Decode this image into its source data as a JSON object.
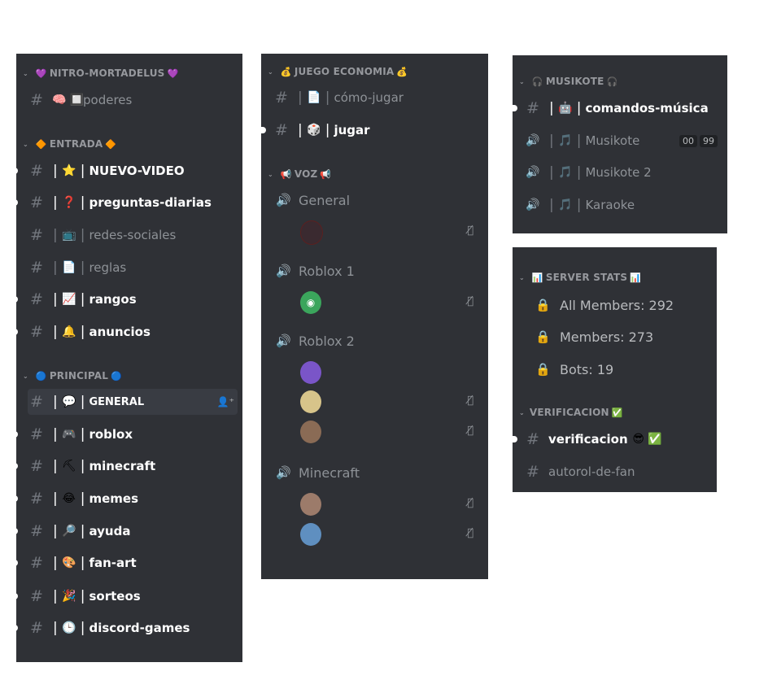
{
  "panel1": {
    "cat1": {
      "label": "NITRO-MORTADELUS",
      "emoji_l": "💜",
      "emoji_r": "💜"
    },
    "c1": {
      "emojis": "🧠 🔲",
      "name": "poderes"
    },
    "cat2": {
      "label": "ENTRADA",
      "emoji_l": "🔶",
      "emoji_r": "🔶"
    },
    "c2": {
      "emoji": "⭐",
      "name": "NUEVO-VIDEO"
    },
    "c3": {
      "emoji": "❓",
      "name": "preguntas-diarias"
    },
    "c4": {
      "emoji": "📺",
      "name": "redes-sociales"
    },
    "c5": {
      "emoji": "📄",
      "name": "reglas"
    },
    "c6": {
      "emoji": "📈",
      "name": "rangos"
    },
    "c7": {
      "emoji": "🔔",
      "name": "anuncios"
    },
    "cat3": {
      "label": "PRINCIPAL",
      "emoji_l": "🔵",
      "emoji_r": "🔵"
    },
    "c8": {
      "emoji": "💬",
      "name": "GENERAL"
    },
    "c9": {
      "emoji": "🎮",
      "name": "roblox"
    },
    "c10": {
      "emoji": "⛏",
      "name": "minecraft"
    },
    "c11": {
      "emoji": "😂",
      "name": "memes"
    },
    "c12": {
      "emoji": "🔎",
      "name": "ayuda"
    },
    "c13": {
      "emoji": "🎨",
      "name": "fan-art"
    },
    "c14": {
      "emoji": "🎉",
      "name": "sorteos"
    },
    "c15": {
      "emoji": "🕒",
      "name": "discord-games"
    }
  },
  "panel2": {
    "cat1": {
      "label": "JUEGO ECONOMIA",
      "emoji_l": "💰",
      "emoji_r": "💰"
    },
    "c1": {
      "emoji": "📄",
      "name": "cómo-jugar"
    },
    "c2": {
      "emoji": "🎲",
      "name": "jugar"
    },
    "cat2": {
      "label": "VOZ",
      "emoji_l": "📢",
      "emoji_r": "📢"
    },
    "v1": "General",
    "v2": "Roblox 1",
    "v3": "Roblox 2",
    "v4": "Minecraft"
  },
  "panel3": {
    "cat1": {
      "label": "MUSIKOTE",
      "emoji_l": "🎧",
      "emoji_r": "🎧"
    },
    "c1": {
      "emoji": "🤖",
      "name": "comandos-música"
    },
    "v1": {
      "emoji": "🎵",
      "name": "Musikote",
      "badge1": "00",
      "badge2": "99"
    },
    "v2": {
      "emoji": "🎵",
      "name": "Musikote 2"
    },
    "v3": {
      "emoji": "🎵",
      "name": "Karaoke"
    }
  },
  "panel4": {
    "cat1": {
      "label": "SERVER STATS",
      "emoji_l": "📊",
      "emoji_r": "📊"
    },
    "s1": "All Members: 292",
    "s2": "Members: 273",
    "s3": "Bots: 19",
    "cat2": {
      "label": "VERIFICACION",
      "emoji_r": "✅"
    },
    "c1": {
      "name": "verificacion",
      "emojis": "😎 ✅"
    },
    "c2": {
      "name": "autorol-de-fan"
    }
  },
  "colors": {
    "bg": "#2f3136",
    "active": "#393c43",
    "muted": "#8e9297",
    "white": "#ffffff",
    "discord": "#3ba55c"
  }
}
